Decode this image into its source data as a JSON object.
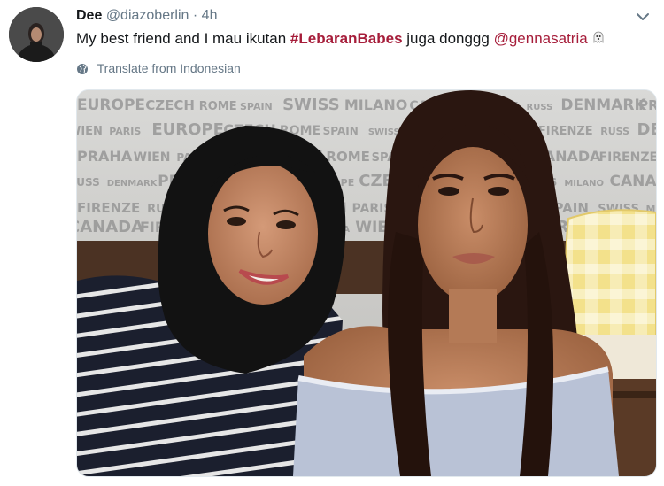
{
  "author": {
    "name": "Dee",
    "handle": "@diazoberlin",
    "time": "4h"
  },
  "tweet": {
    "segments": [
      "My best friend and I mau ikutan ",
      " juga donggg "
    ],
    "hashtag": "#LebaranBabes",
    "mention": "@gennasatria"
  },
  "translate_label": "Translate from Indonesian",
  "backdrop_words": [
    "EUROPE",
    "CZECH",
    "ROME",
    "SPAIN",
    "SWISS",
    "MILANO",
    "CANADA",
    "FIRENZE",
    "RUSS",
    "DENMARK",
    "PRAHA",
    "WIEN",
    "PARIS"
  ],
  "colors": {
    "link": "#a61d3a",
    "secondary": "#657786"
  },
  "icons": {
    "globe": "globe-icon",
    "chevron": "chevron-down-icon",
    "emoji": "ghost-emoji"
  }
}
